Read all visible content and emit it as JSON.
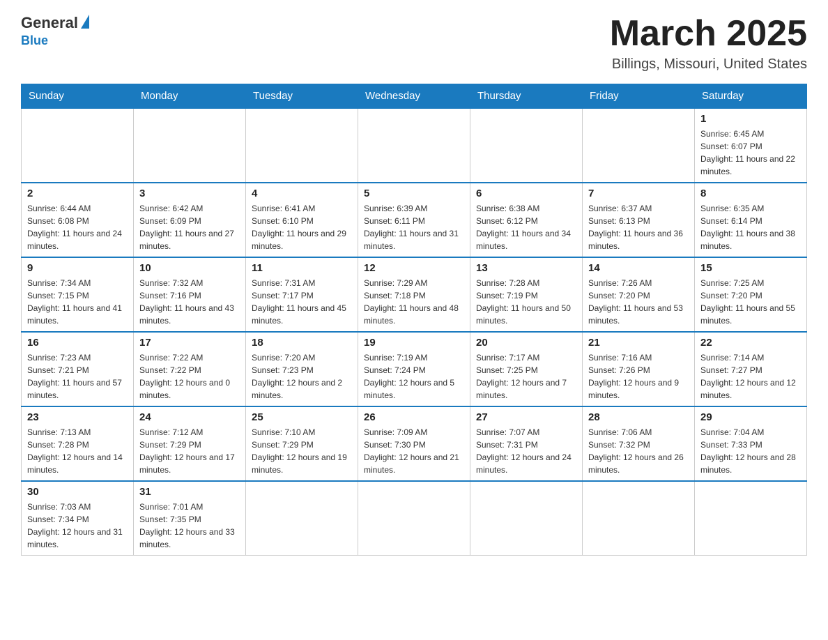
{
  "header": {
    "logo_general": "General",
    "logo_blue": "Blue",
    "cal_title": "March 2025",
    "cal_subtitle": "Billings, Missouri, United States"
  },
  "weekdays": [
    "Sunday",
    "Monday",
    "Tuesday",
    "Wednesday",
    "Thursday",
    "Friday",
    "Saturday"
  ],
  "weeks": [
    [
      {
        "day": "",
        "info": ""
      },
      {
        "day": "",
        "info": ""
      },
      {
        "day": "",
        "info": ""
      },
      {
        "day": "",
        "info": ""
      },
      {
        "day": "",
        "info": ""
      },
      {
        "day": "",
        "info": ""
      },
      {
        "day": "1",
        "info": "Sunrise: 6:45 AM\nSunset: 6:07 PM\nDaylight: 11 hours and 22 minutes."
      }
    ],
    [
      {
        "day": "2",
        "info": "Sunrise: 6:44 AM\nSunset: 6:08 PM\nDaylight: 11 hours and 24 minutes."
      },
      {
        "day": "3",
        "info": "Sunrise: 6:42 AM\nSunset: 6:09 PM\nDaylight: 11 hours and 27 minutes."
      },
      {
        "day": "4",
        "info": "Sunrise: 6:41 AM\nSunset: 6:10 PM\nDaylight: 11 hours and 29 minutes."
      },
      {
        "day": "5",
        "info": "Sunrise: 6:39 AM\nSunset: 6:11 PM\nDaylight: 11 hours and 31 minutes."
      },
      {
        "day": "6",
        "info": "Sunrise: 6:38 AM\nSunset: 6:12 PM\nDaylight: 11 hours and 34 minutes."
      },
      {
        "day": "7",
        "info": "Sunrise: 6:37 AM\nSunset: 6:13 PM\nDaylight: 11 hours and 36 minutes."
      },
      {
        "day": "8",
        "info": "Sunrise: 6:35 AM\nSunset: 6:14 PM\nDaylight: 11 hours and 38 minutes."
      }
    ],
    [
      {
        "day": "9",
        "info": "Sunrise: 7:34 AM\nSunset: 7:15 PM\nDaylight: 11 hours and 41 minutes."
      },
      {
        "day": "10",
        "info": "Sunrise: 7:32 AM\nSunset: 7:16 PM\nDaylight: 11 hours and 43 minutes."
      },
      {
        "day": "11",
        "info": "Sunrise: 7:31 AM\nSunset: 7:17 PM\nDaylight: 11 hours and 45 minutes."
      },
      {
        "day": "12",
        "info": "Sunrise: 7:29 AM\nSunset: 7:18 PM\nDaylight: 11 hours and 48 minutes."
      },
      {
        "day": "13",
        "info": "Sunrise: 7:28 AM\nSunset: 7:19 PM\nDaylight: 11 hours and 50 minutes."
      },
      {
        "day": "14",
        "info": "Sunrise: 7:26 AM\nSunset: 7:20 PM\nDaylight: 11 hours and 53 minutes."
      },
      {
        "day": "15",
        "info": "Sunrise: 7:25 AM\nSunset: 7:20 PM\nDaylight: 11 hours and 55 minutes."
      }
    ],
    [
      {
        "day": "16",
        "info": "Sunrise: 7:23 AM\nSunset: 7:21 PM\nDaylight: 11 hours and 57 minutes."
      },
      {
        "day": "17",
        "info": "Sunrise: 7:22 AM\nSunset: 7:22 PM\nDaylight: 12 hours and 0 minutes."
      },
      {
        "day": "18",
        "info": "Sunrise: 7:20 AM\nSunset: 7:23 PM\nDaylight: 12 hours and 2 minutes."
      },
      {
        "day": "19",
        "info": "Sunrise: 7:19 AM\nSunset: 7:24 PM\nDaylight: 12 hours and 5 minutes."
      },
      {
        "day": "20",
        "info": "Sunrise: 7:17 AM\nSunset: 7:25 PM\nDaylight: 12 hours and 7 minutes."
      },
      {
        "day": "21",
        "info": "Sunrise: 7:16 AM\nSunset: 7:26 PM\nDaylight: 12 hours and 9 minutes."
      },
      {
        "day": "22",
        "info": "Sunrise: 7:14 AM\nSunset: 7:27 PM\nDaylight: 12 hours and 12 minutes."
      }
    ],
    [
      {
        "day": "23",
        "info": "Sunrise: 7:13 AM\nSunset: 7:28 PM\nDaylight: 12 hours and 14 minutes."
      },
      {
        "day": "24",
        "info": "Sunrise: 7:12 AM\nSunset: 7:29 PM\nDaylight: 12 hours and 17 minutes."
      },
      {
        "day": "25",
        "info": "Sunrise: 7:10 AM\nSunset: 7:29 PM\nDaylight: 12 hours and 19 minutes."
      },
      {
        "day": "26",
        "info": "Sunrise: 7:09 AM\nSunset: 7:30 PM\nDaylight: 12 hours and 21 minutes."
      },
      {
        "day": "27",
        "info": "Sunrise: 7:07 AM\nSunset: 7:31 PM\nDaylight: 12 hours and 24 minutes."
      },
      {
        "day": "28",
        "info": "Sunrise: 7:06 AM\nSunset: 7:32 PM\nDaylight: 12 hours and 26 minutes."
      },
      {
        "day": "29",
        "info": "Sunrise: 7:04 AM\nSunset: 7:33 PM\nDaylight: 12 hours and 28 minutes."
      }
    ],
    [
      {
        "day": "30",
        "info": "Sunrise: 7:03 AM\nSunset: 7:34 PM\nDaylight: 12 hours and 31 minutes."
      },
      {
        "day": "31",
        "info": "Sunrise: 7:01 AM\nSunset: 7:35 PM\nDaylight: 12 hours and 33 minutes."
      },
      {
        "day": "",
        "info": ""
      },
      {
        "day": "",
        "info": ""
      },
      {
        "day": "",
        "info": ""
      },
      {
        "day": "",
        "info": ""
      },
      {
        "day": "",
        "info": ""
      }
    ]
  ]
}
